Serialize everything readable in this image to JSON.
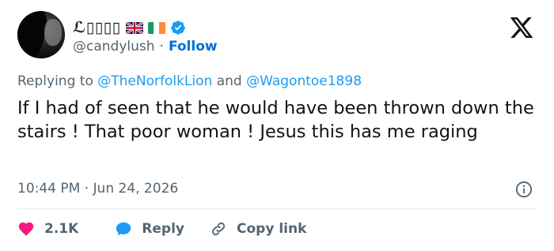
{
  "tweet": {
    "display_name": "ℒ▯▯▯▯",
    "handle": "@candylush",
    "separator": "·",
    "follow_label": "Follow",
    "replying_prefix": "Replying to",
    "replying_user1": "@TheNorfolkLion",
    "replying_and": "and",
    "replying_user2": "@Wagontoe1898",
    "text": "If I had of seen that he would have been thrown down the stairs ! That poor woman ! Jesus this has me raging",
    "timestamp": "10:44 PM · Jun 24, 2026"
  },
  "actions": {
    "likes": "2.1K",
    "reply_label": "Reply",
    "copy_label": "Copy link"
  },
  "colors": {
    "accent": "#1d9bf0",
    "follow": "#006fd6",
    "like": "#f91880",
    "muted": "#536471",
    "text": "#0f1419"
  },
  "icons": [
    "x-logo-icon",
    "verified-badge-icon",
    "uk-flag-icon",
    "ireland-flag-icon",
    "info-icon",
    "heart-icon",
    "reply-bubble-icon",
    "link-icon"
  ]
}
